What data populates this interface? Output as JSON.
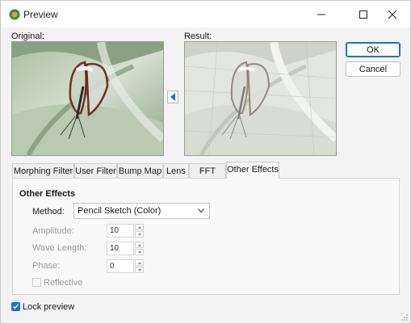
{
  "window": {
    "title": "Preview"
  },
  "preview": {
    "original_label": "Original:",
    "result_label": "Result:"
  },
  "actions": {
    "ok_label": "OK",
    "cancel_label": "Cancel"
  },
  "tabs": [
    {
      "label": "Morphing Filter"
    },
    {
      "label": "User Filter"
    },
    {
      "label": "Bump Map"
    },
    {
      "label": "Lens"
    },
    {
      "label": "FFT"
    },
    {
      "label": "Other Effects"
    }
  ],
  "active_tab": "Other Effects",
  "effects": {
    "group_title": "Other Effects",
    "method_label": "Method:",
    "method_value": "Pencil Sketch (Color)",
    "amplitude_label": "Amplitude:",
    "amplitude_value": "10",
    "wavelength_label": "Wave Length:",
    "wavelength_value": "10",
    "phase_label": "Phase:",
    "phase_value": "0",
    "reflective_label": "Reflective",
    "reflective_checked": false
  },
  "lock_preview": {
    "label": "Lock preview",
    "checked": true
  },
  "colors": {
    "accent": "#1f6fd1",
    "disabled_text": "#9a9a9a",
    "panel": "#f9f9f9",
    "window": "#f3f3f3"
  },
  "icons": {
    "app": "preview-app-icon",
    "minimize": "minimize-icon",
    "maximize": "maximize-icon",
    "close": "close-icon",
    "apply_left": "arrow-left-icon",
    "dropdown": "chevron-down-icon",
    "check": "checkmark-icon",
    "resize": "resize-grip-icon"
  }
}
